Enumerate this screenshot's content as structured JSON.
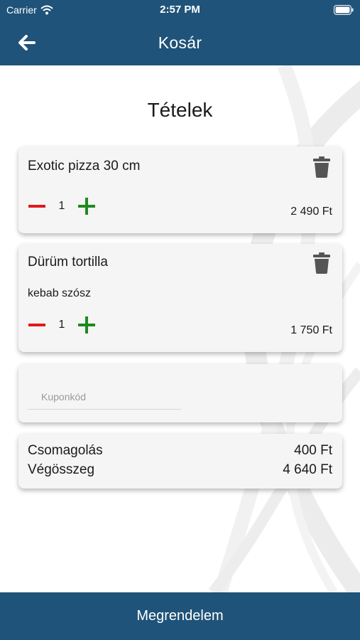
{
  "status_bar": {
    "carrier": "Carrier",
    "time": "2:57 PM"
  },
  "nav": {
    "title": "Kosár"
  },
  "section": {
    "title": "Tételek"
  },
  "items": [
    {
      "name": "Exotic pizza 30 cm",
      "option": "",
      "quantity": "1",
      "price": "2 490 Ft"
    },
    {
      "name": "Dürüm tortilla",
      "option": "kebab szósz",
      "quantity": "1",
      "price": "1 750 Ft"
    }
  ],
  "coupon": {
    "placeholder": "Kuponkód",
    "value": ""
  },
  "summary": {
    "packaging_label": "Csomagolás",
    "packaging_value": "400 Ft",
    "total_label": "Végösszeg",
    "total_value": "4 640 Ft"
  },
  "footer": {
    "order_label": "Megrendelem"
  },
  "colors": {
    "primary": "#1f5379",
    "minus": "#e0191b",
    "plus": "#1e8a1e",
    "trash": "#555555"
  },
  "icons": {
    "back": "arrow-left-icon",
    "delete": "trash-icon",
    "decrease": "minus-icon",
    "increase": "plus-icon",
    "wifi": "wifi-icon",
    "battery": "battery-icon"
  }
}
